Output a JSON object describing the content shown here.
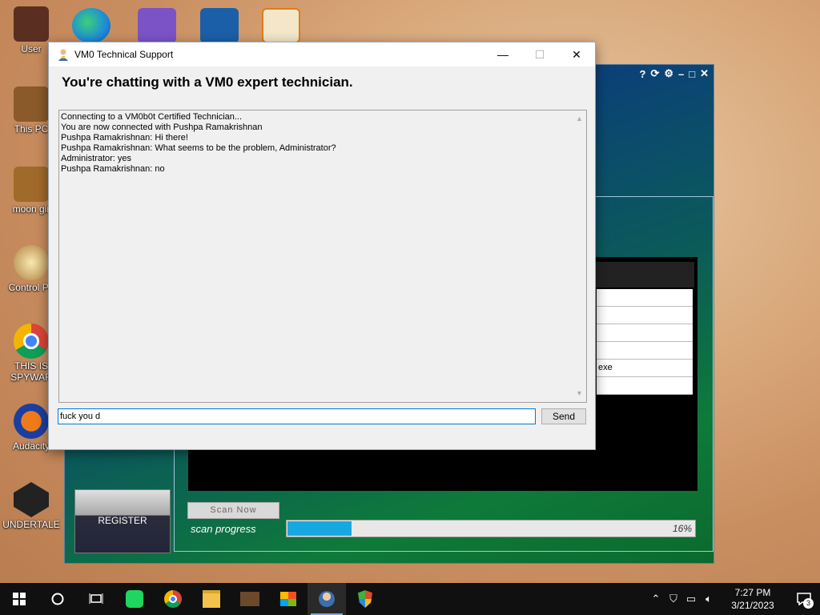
{
  "desktop": {
    "icons": [
      {
        "label": "User"
      },
      {
        "label": "This PC"
      },
      {
        "label": "moon gir"
      },
      {
        "label": "Control Pa"
      },
      {
        "label": "THIS IS SPYWAR"
      },
      {
        "label": "Audacity"
      },
      {
        "label": "UNDERTALE"
      }
    ]
  },
  "scanner": {
    "rows": [
      "",
      "",
      "",
      "",
      "exe",
      ""
    ],
    "scan_button": "Scan Now",
    "scan_label": "scan progress",
    "progress": 16,
    "progress_text": "16%",
    "register": "REGISTER"
  },
  "chat": {
    "title": "VM0 Technical Support",
    "headline": "You're chatting with a VM0 expert technician.",
    "messages": [
      "Connecting to a VM0b0t Certified Technician...",
      "You are now connected with Pushpa Ramakrishnan",
      "Pushpa Ramakrishnan: Hi there!",
      "Pushpa Ramakrishnan: What seems to be the problem, Administrator?",
      "Administrator: yes",
      "Pushpa Ramakrishnan: no"
    ],
    "input_value": "fuck you d",
    "send": "Send"
  },
  "taskbar": {
    "time": "7:27 PM",
    "date": "3/21/2023",
    "notifications": "3"
  },
  "colors": {
    "progress_fill": "#18a8e0",
    "input_focus": "#0078d7"
  }
}
